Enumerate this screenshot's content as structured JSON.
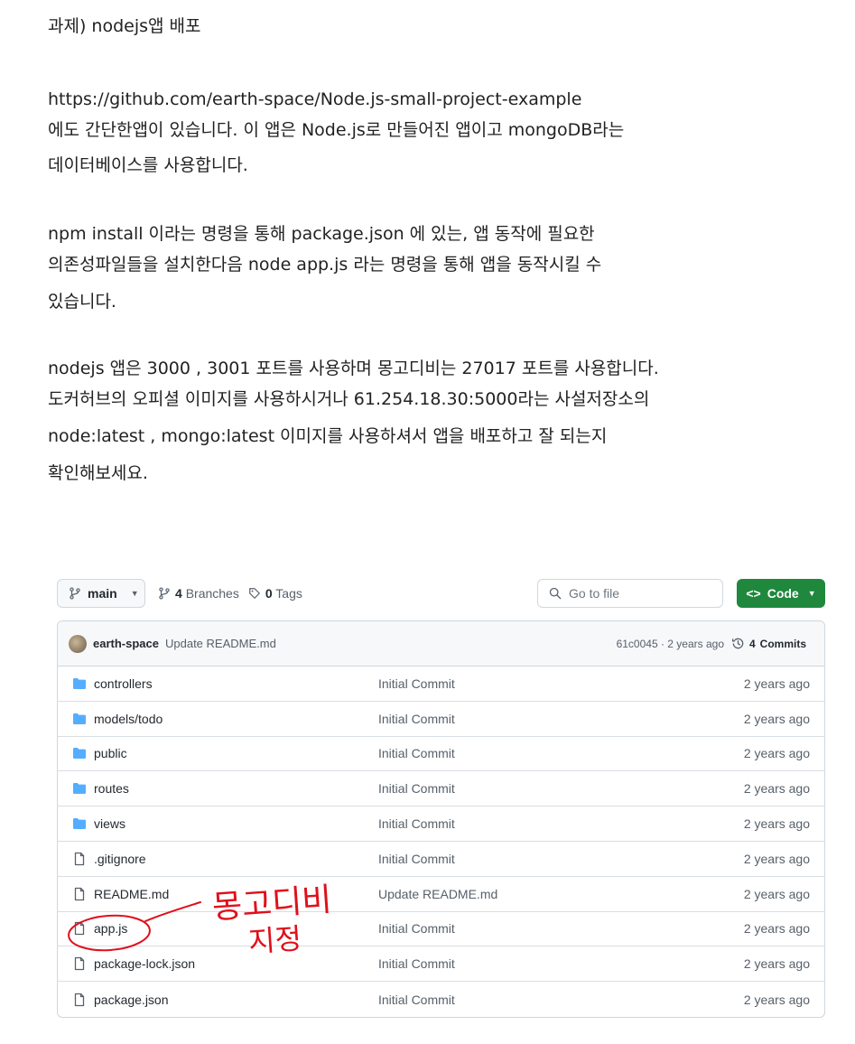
{
  "document": {
    "title": "과제) nodejs앱 배포",
    "para1": [
      "https://github.com/earth-space/Node.js-small-project-example",
      "에도 간단한앱이 있습니다. 이 앱은 Node.js로 만들어진 앱이고 mongoDB라는",
      "데이터베이스를 사용합니다."
    ],
    "para2": [
      "npm install 이라는 명령을 통해 package.json 에 있는, 앱 동작에 필요한",
      "의존성파일들을 설치한다음 node app.js 라는 명령을 통해 앱을 동작시킬 수",
      "있습니다."
    ],
    "para3": [
      "nodejs 앱은 3000 , 3001 포트를 사용하며 몽고디비는 27017 포트를 사용합니다.",
      "도커허브의 오피셜 이미지를 사용하시거나 61.254.18.30:5000라는 사설저장소의",
      "node:latest , mongo:latest 이미지를 사용하셔서 앱을 배포하고 잘 되는지",
      "확인해보세요."
    ]
  },
  "repo": {
    "branch": "main",
    "branches_count": "4",
    "branches_label": "Branches",
    "tags_count": "0",
    "tags_label": "Tags",
    "search_placeholder": "Go to file",
    "code_label": "Code",
    "latest_commit": {
      "author": "earth-space",
      "message": "Update README.md",
      "sha_age": "61c0045 · 2 years ago",
      "commits_count": "4",
      "commits_label": "Commits"
    },
    "files": [
      {
        "type": "folder",
        "name": "controllers",
        "message": "Initial Commit",
        "age": "2 years ago"
      },
      {
        "type": "folder",
        "name": "models/todo",
        "message": "Initial Commit",
        "age": "2 years ago"
      },
      {
        "type": "folder",
        "name": "public",
        "message": "Initial Commit",
        "age": "2 years ago"
      },
      {
        "type": "folder",
        "name": "routes",
        "message": "Initial Commit",
        "age": "2 years ago"
      },
      {
        "type": "folder",
        "name": "views",
        "message": "Initial Commit",
        "age": "2 years ago"
      },
      {
        "type": "file",
        "name": ".gitignore",
        "message": "Initial Commit",
        "age": "2 years ago"
      },
      {
        "type": "file",
        "name": "README.md",
        "message": "Update README.md",
        "age": "2 years ago"
      },
      {
        "type": "file",
        "name": "app.js",
        "message": "Initial Commit",
        "age": "2 years ago"
      },
      {
        "type": "file",
        "name": "package-lock.json",
        "message": "Initial Commit",
        "age": "2 years ago"
      },
      {
        "type": "file",
        "name": "package.json",
        "message": "Initial Commit",
        "age": "2 years ago"
      }
    ]
  },
  "annotation": {
    "line1": "몽고디비",
    "line2": "지정",
    "color": "#e0101a"
  },
  "colors": {
    "folder": "#54aeff",
    "code_button": "#1f883d"
  }
}
